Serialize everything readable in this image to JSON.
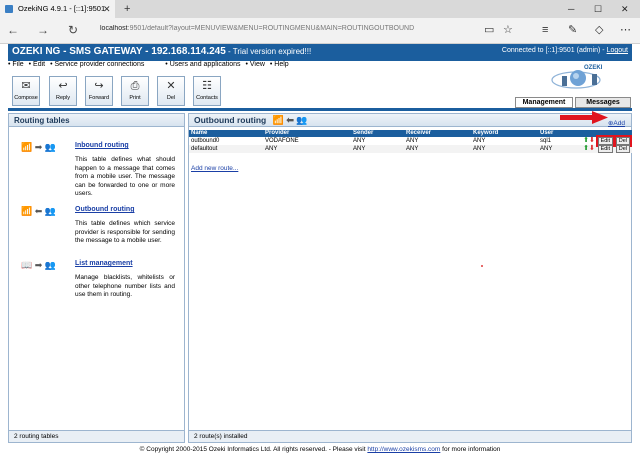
{
  "browser": {
    "tab_title": "OzekiNG 4.9.1 - [::1]:9501",
    "address_host": "localhost",
    "address_rest": ":9501/default?layout=MENUVIEW&MENU=ROUTINGMENU&MAIN=ROUTINGOUTBOUND"
  },
  "app": {
    "title": "OZEKI NG - SMS GATEWAY - 192.168.114.245",
    "trial": " - Trial version expired!!!",
    "connected_text": "Connected to [::1]:9501 (admin) - ",
    "logout": "Logout",
    "logo_text": "OZEKI"
  },
  "menu": [
    "• File",
    "• Edit",
    "• Service provider connections",
    "• Users and applications",
    "• View",
    "• Help"
  ],
  "toolbar": [
    "Compose",
    "Reply",
    "Forward",
    "Print",
    "Del",
    "Contacts"
  ],
  "mode_tabs": [
    "Management",
    "Messages"
  ],
  "left_panel": {
    "title": "Routing tables",
    "items": [
      {
        "label": "Inbound routing",
        "desc": "This table defines what should happen to a message that comes from a mobile user. The message can be forwarded to one or more users."
      },
      {
        "label": "Outbound routing",
        "desc": "This table defines which service provider is responsible for sending the message to a mobile user."
      },
      {
        "label": "List management",
        "desc": "Manage blacklists, whitelists or other telephone number lists and use them in routing."
      }
    ],
    "footer": "2 routing tables"
  },
  "right_panel": {
    "title": "Outbound routing",
    "add": "Add",
    "columns": [
      "Name",
      "Provider",
      "Sender",
      "Receiver",
      "Keyword",
      "User"
    ],
    "rows": [
      {
        "name": "outbound0",
        "provider": "VODAFONE",
        "sender": "ANY",
        "receiver": "ANY",
        "keyword": "ANY",
        "user": "sql1"
      },
      {
        "name": "defaultout",
        "provider": "ANY",
        "sender": "ANY",
        "receiver": "ANY",
        "keyword": "ANY",
        "user": "ANY"
      }
    ],
    "edit": "Edit",
    "del": "Del",
    "new_route": "Add new route...",
    "footer": "2 route(s) installed"
  },
  "footer": {
    "text": "© Copyright 2000-2015 Ozeki Informatics Ltd. All rights reserved. - Please visit ",
    "link": "http://www.ozekisms.com",
    "after": " for more information"
  },
  "colors": {
    "header_blue": "#1b5e9e",
    "highlight_red": "#e0141e"
  }
}
